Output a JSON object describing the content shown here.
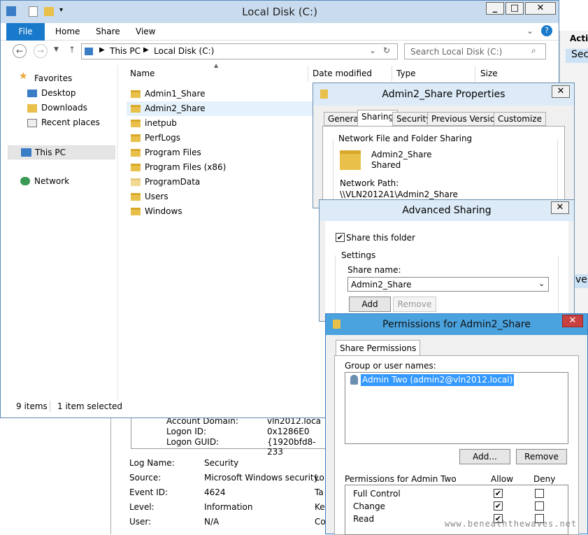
{
  "explorer": {
    "title": "Local Disk (C:)",
    "ribbon_tabs": [
      "File",
      "Home",
      "Share",
      "View"
    ],
    "breadcrumb": [
      "This PC",
      "Local Disk (C:)"
    ],
    "search_placeholder": "Search Local Disk (C:)",
    "columns": [
      "Name",
      "Date modified",
      "Type",
      "Size"
    ],
    "nav": {
      "favorites": "Favorites",
      "desktop": "Desktop",
      "downloads": "Downloads",
      "recent": "Recent places",
      "thispc": "This PC",
      "network": "Network"
    },
    "files": [
      "Admin1_Share",
      "Admin2_Share",
      "inetpub",
      "PerfLogs",
      "Program Files",
      "Program Files (x86)",
      "ProgramData",
      "Users",
      "Windows"
    ],
    "status": {
      "items": "9 items",
      "selected": "1 item selected"
    }
  },
  "background": {
    "top_right": [
      "Actio",
      "Sec",
      "ve"
    ],
    "event_top": [
      {
        "label": "Account Domain:",
        "value": "vln2012.loca"
      },
      {
        "label": "Logon ID:",
        "value": "0x1286E0"
      },
      {
        "label": "Logon GUID:",
        "value": "{1920bfd8-233"
      }
    ],
    "event": [
      {
        "label": "Log Name:",
        "value": "Security",
        "extra": ""
      },
      {
        "label": "Source:",
        "value": "Microsoft Windows security",
        "extra": "Lo"
      },
      {
        "label": "Event ID:",
        "value": "4624",
        "extra": "Ta"
      },
      {
        "label": "Level:",
        "value": "Information",
        "extra": "Ke"
      },
      {
        "label": "User:",
        "value": "N/A",
        "extra": "Co"
      }
    ]
  },
  "properties": {
    "title": "Admin2_Share Properties",
    "tabs": [
      "General",
      "Sharing",
      "Security",
      "Previous Versions",
      "Customize"
    ],
    "group_title": "Network File and Folder Sharing",
    "folder_name": "Admin2_Share",
    "folder_state": "Shared",
    "path_label": "Network Path:",
    "path_value": "\\\\VLN2012A1\\Admin2_Share"
  },
  "advanced": {
    "title": "Advanced Sharing",
    "share_checkbox": "Share this folder",
    "settings_label": "Settings",
    "share_name_label": "Share name:",
    "share_name_value": "Admin2_Share",
    "add_label": "Add",
    "remove_label": "Remove"
  },
  "permissions": {
    "title": "Permissions for Admin2_Share",
    "tab": "Share Permissions",
    "group_label": "Group or user names:",
    "user": "Admin Two (admin2@vln2012.local)",
    "add_label": "Add...",
    "remove_label": "Remove",
    "perm_header": "Permissions for Admin Two",
    "allow": "Allow",
    "deny": "Deny",
    "rows": [
      {
        "name": "Full Control",
        "allow": true,
        "deny": false
      },
      {
        "name": "Change",
        "allow": true,
        "deny": false
      },
      {
        "name": "Read",
        "allow": true,
        "deny": false
      }
    ]
  },
  "watermark": "www.beneaththewaves.net"
}
